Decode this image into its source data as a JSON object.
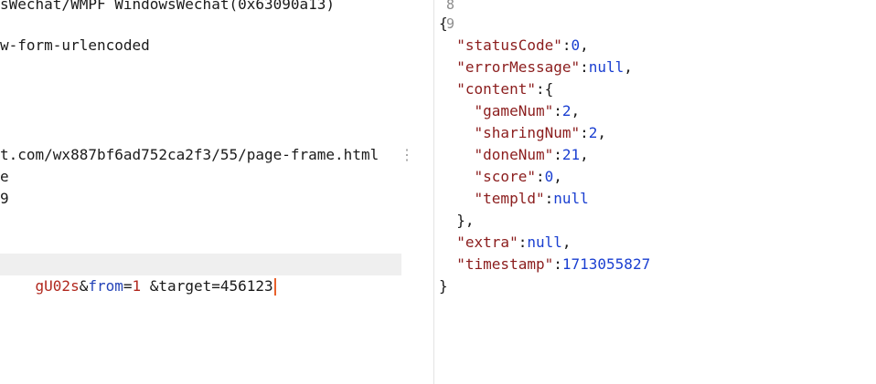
{
  "request": {
    "line1": "sWechat/WMPF WindowsWechat(0x63090a13)",
    "line2": "w-form-urlencoded",
    "line3": "t.com/wx887bf6ad752ca2f3/55/page-frame.html",
    "line4": "e",
    "line5": "9",
    "kebab_glyph": "⋮",
    "body": {
      "seg1": "gU02s",
      "amp1": "&",
      "key_from": "from",
      "eq1": "=",
      "val_from": "1",
      "rest": " &target=456123"
    }
  },
  "response": {
    "gutter": [
      "8",
      "9"
    ],
    "lines": [
      {
        "indent": "",
        "parts": [
          {
            "t": "{",
            "c": "pn"
          }
        ]
      },
      {
        "indent": "  ",
        "parts": [
          {
            "t": "\"statusCode\"",
            "c": "k"
          },
          {
            "t": ":",
            "c": "pn"
          },
          {
            "t": "0",
            "c": "n"
          },
          {
            "t": ",",
            "c": "pn"
          }
        ]
      },
      {
        "indent": "  ",
        "parts": [
          {
            "t": "\"errorMessage\"",
            "c": "k"
          },
          {
            "t": ":",
            "c": "pn"
          },
          {
            "t": "null",
            "c": "kw"
          },
          {
            "t": ",",
            "c": "pn"
          }
        ]
      },
      {
        "indent": "  ",
        "parts": [
          {
            "t": "\"content\"",
            "c": "k"
          },
          {
            "t": ":{",
            "c": "pn"
          }
        ]
      },
      {
        "indent": "    ",
        "parts": [
          {
            "t": "\"gameNum\"",
            "c": "k"
          },
          {
            "t": ":",
            "c": "pn"
          },
          {
            "t": "2",
            "c": "n"
          },
          {
            "t": ",",
            "c": "pn"
          }
        ]
      },
      {
        "indent": "    ",
        "parts": [
          {
            "t": "\"sharingNum\"",
            "c": "k"
          },
          {
            "t": ":",
            "c": "pn"
          },
          {
            "t": "2",
            "c": "n"
          },
          {
            "t": ",",
            "c": "pn"
          }
        ]
      },
      {
        "indent": "    ",
        "parts": [
          {
            "t": "\"doneNum\"",
            "c": "k"
          },
          {
            "t": ":",
            "c": "pn"
          },
          {
            "t": "21",
            "c": "n"
          },
          {
            "t": ",",
            "c": "pn"
          }
        ]
      },
      {
        "indent": "    ",
        "parts": [
          {
            "t": "\"score\"",
            "c": "k"
          },
          {
            "t": ":",
            "c": "pn"
          },
          {
            "t": "0",
            "c": "n"
          },
          {
            "t": ",",
            "c": "pn"
          }
        ]
      },
      {
        "indent": "    ",
        "parts": [
          {
            "t": "\"templd\"",
            "c": "k"
          },
          {
            "t": ":",
            "c": "pn"
          },
          {
            "t": "null",
            "c": "kw"
          }
        ]
      },
      {
        "indent": "  ",
        "parts": [
          {
            "t": "},",
            "c": "pn"
          }
        ]
      },
      {
        "indent": "  ",
        "parts": [
          {
            "t": "\"extra\"",
            "c": "k"
          },
          {
            "t": ":",
            "c": "pn"
          },
          {
            "t": "null",
            "c": "kw"
          },
          {
            "t": ",",
            "c": "pn"
          }
        ]
      },
      {
        "indent": "  ",
        "parts": [
          {
            "t": "\"timestamp\"",
            "c": "k"
          },
          {
            "t": ":",
            "c": "pn"
          },
          {
            "t": "1713055827",
            "c": "n"
          }
        ]
      },
      {
        "indent": "",
        "parts": [
          {
            "t": "}",
            "c": "pn"
          }
        ]
      }
    ]
  }
}
